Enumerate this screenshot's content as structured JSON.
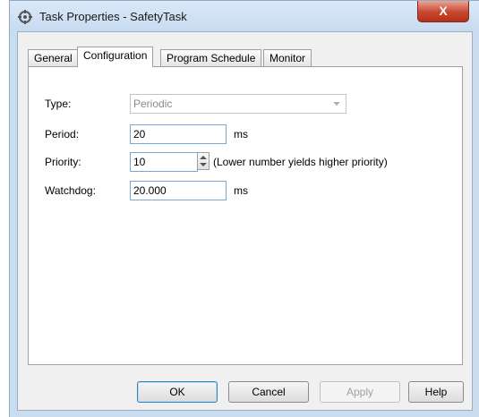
{
  "window": {
    "title": "Task Properties - SafetyTask",
    "close_glyph": "X"
  },
  "tabs": [
    {
      "label": "General",
      "active": false
    },
    {
      "label": "Configuration",
      "active": true
    },
    {
      "label": "Program Schedule",
      "active": false
    },
    {
      "label": "Monitor",
      "active": false
    }
  ],
  "configuration": {
    "type": {
      "label": "Type:",
      "value": "Periodic",
      "enabled": false
    },
    "period": {
      "label": "Period:",
      "value": "20",
      "unit": "ms"
    },
    "priority": {
      "label": "Priority:",
      "value": "10",
      "hint": "(Lower number yields higher priority)"
    },
    "watchdog": {
      "label": "Watchdog:",
      "value": "20.000",
      "unit": "ms"
    }
  },
  "buttons": {
    "ok": "OK",
    "cancel": "Cancel",
    "apply": "Apply",
    "help": "Help"
  },
  "colors": {
    "title_bar": "#c7dbf1",
    "close_button": "#c8462f",
    "dialog_bg": "#f0f0f0",
    "field_border_focus": "#7aa6d6"
  }
}
